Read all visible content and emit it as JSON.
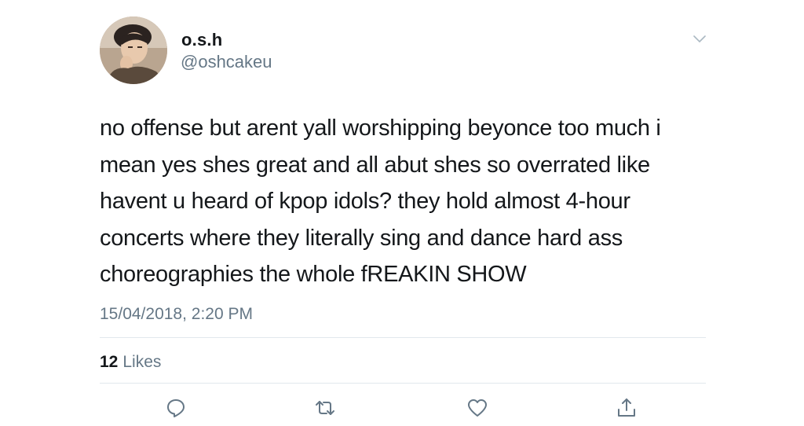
{
  "user": {
    "display_name": "o.s.h",
    "handle": "@oshcakeu"
  },
  "tweet": {
    "text": "no offense but arent yall worshipping beyonce too much i mean yes shes great and all abut shes so overrated like havent u heard of kpop idols? they hold almost 4-hour concerts where they literally sing and dance hard ass choreographies the whole fREAKIN SHOW",
    "timestamp": "15/04/2018, 2:20 PM"
  },
  "stats": {
    "likes_count": "12",
    "likes_label": "Likes"
  },
  "icons": {
    "menu": "chevron-down-icon",
    "reply": "reply-icon",
    "retweet": "retweet-icon",
    "like": "heart-icon",
    "share": "share-icon"
  },
  "colors": {
    "text": "#14171a",
    "secondary": "#657786",
    "divider": "#e1e8ed"
  }
}
